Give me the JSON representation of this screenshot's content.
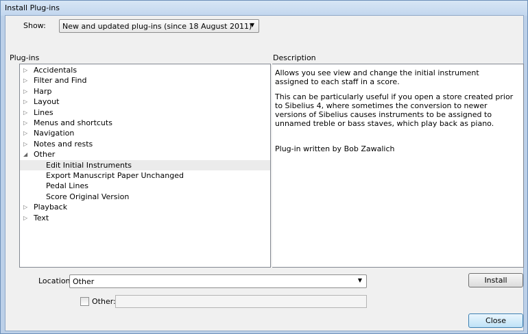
{
  "window": {
    "title": "Install Plug-ins"
  },
  "show": {
    "label": "Show:",
    "value": "New and updated plug-ins (since 18 August 2011)"
  },
  "plugins_label": "Plug-ins",
  "description_label": "Description",
  "tree": [
    {
      "label": "Accidentals",
      "expander": "▷"
    },
    {
      "label": "Filter and Find",
      "expander": "▷"
    },
    {
      "label": "Harp",
      "expander": "▷"
    },
    {
      "label": "Layout",
      "expander": "▷"
    },
    {
      "label": "Lines",
      "expander": "▷"
    },
    {
      "label": "Menus and shortcuts",
      "expander": "▷"
    },
    {
      "label": "Navigation",
      "expander": "▷"
    },
    {
      "label": "Notes and rests",
      "expander": "▷"
    },
    {
      "label": "Other",
      "expander": "◢"
    },
    {
      "label": "Edit Initial Instruments",
      "child": true,
      "selected": true
    },
    {
      "label": "Export Manuscript Paper Unchanged",
      "child": true
    },
    {
      "label": "Pedal Lines",
      "child": true
    },
    {
      "label": "Score Original Version",
      "child": true
    },
    {
      "label": "Playback",
      "expander": "▷"
    },
    {
      "label": "Text",
      "expander": "▷"
    }
  ],
  "description": {
    "p1": "Allows you see view and change the initial instrument assigned to each staff in a score.",
    "p2": "This can be particularly useful if you open a store created prior to Sibelius 4, where sometimes the conversion to newer versions of Sibelius causes instruments to be assigned to unnamed treble or bass staves, which play back as piano.",
    "author": "Plug-in written by Bob Zawalich"
  },
  "location": {
    "label": "Location:",
    "value": "Other"
  },
  "other": {
    "label": "Other:",
    "checked": false,
    "value": ""
  },
  "buttons": {
    "install": "Install",
    "close": "Close"
  },
  "icons": {
    "dropdown": "chevron-down-icon",
    "collapsed": "triangle-right-icon",
    "expanded": "triangle-down-icon"
  }
}
